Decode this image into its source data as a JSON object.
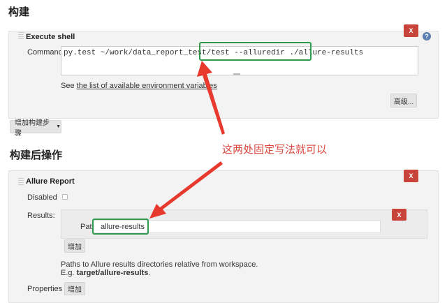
{
  "build": {
    "heading": "构建",
    "step_title": "Execute shell",
    "command_label": "Command",
    "command_value": "py.test ~/work/data_report_test/test --alluredir ./allure-results",
    "env_prefix": "See ",
    "env_link": "the list of available environment variables",
    "advanced_label": "高级...",
    "add_step_label": "增加构建步骤",
    "delete_label": "X"
  },
  "post_build": {
    "heading": "构建后操作",
    "step_title": "Allure Report",
    "disabled_label": "Disabled",
    "results_label": "Results:",
    "path_label": "Path",
    "path_value": "allure-results",
    "add_label": "增加",
    "help_line1": "Paths to Allure results directories relative from workspace.",
    "help_eg": "E.g. ",
    "help_eg_value": "target/allure-results",
    "help_eg_end": ".",
    "properties_label": "Properties",
    "properties_add_label": "增加",
    "delete_label": "X"
  },
  "annotation": {
    "text": "这两处固定写法就可以",
    "color": "#d9463d"
  }
}
